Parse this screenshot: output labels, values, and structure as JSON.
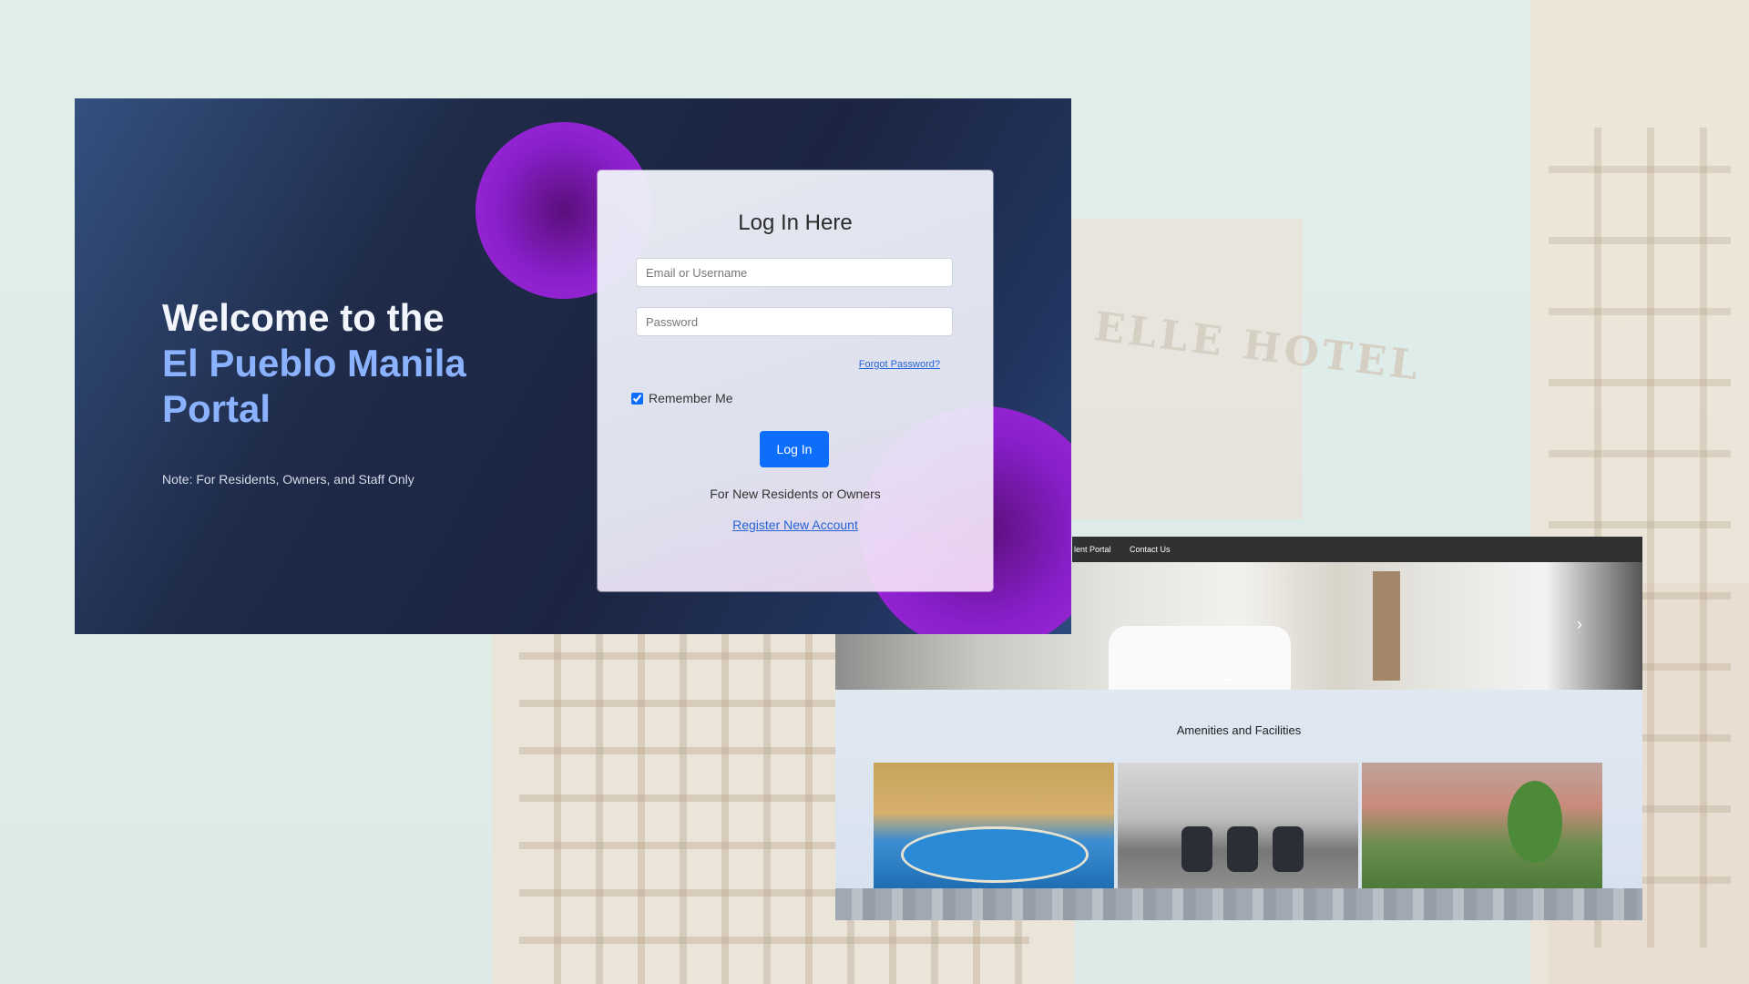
{
  "background": {
    "sign_text": "ELLE HOTEL"
  },
  "hero_panel": {
    "welcome_line1": "Welcome to the",
    "welcome_line2": "El Pueblo Manila",
    "welcome_line3": "Portal",
    "note": "Note: For Residents, Owners, and Staff Only"
  },
  "login_card": {
    "title": "Log In Here",
    "username_placeholder": "Email or Username",
    "password_placeholder": "Password",
    "forgot_link": "Forgot Password?",
    "remember_label": "Remember Me",
    "remember_checked": true,
    "login_button": "Log In",
    "new_user_text": "For New Residents or Owners",
    "register_link": "Register New Account"
  },
  "site_preview": {
    "nav_items": [
      "lent Portal",
      "Contact Us"
    ],
    "carousel_next_icon": "chevron-right-icon",
    "amenities_title": "Amenities and Facilities",
    "photos": [
      "pool-photo",
      "lounge-photo",
      "garden-photo"
    ]
  },
  "colors": {
    "panel_dark": "#1b2541",
    "accent_blue": "#0d6efd",
    "highlight_text": "#8ab2ff",
    "orb_purple": "#8a1fcc",
    "link_blue": "#2563d8"
  }
}
